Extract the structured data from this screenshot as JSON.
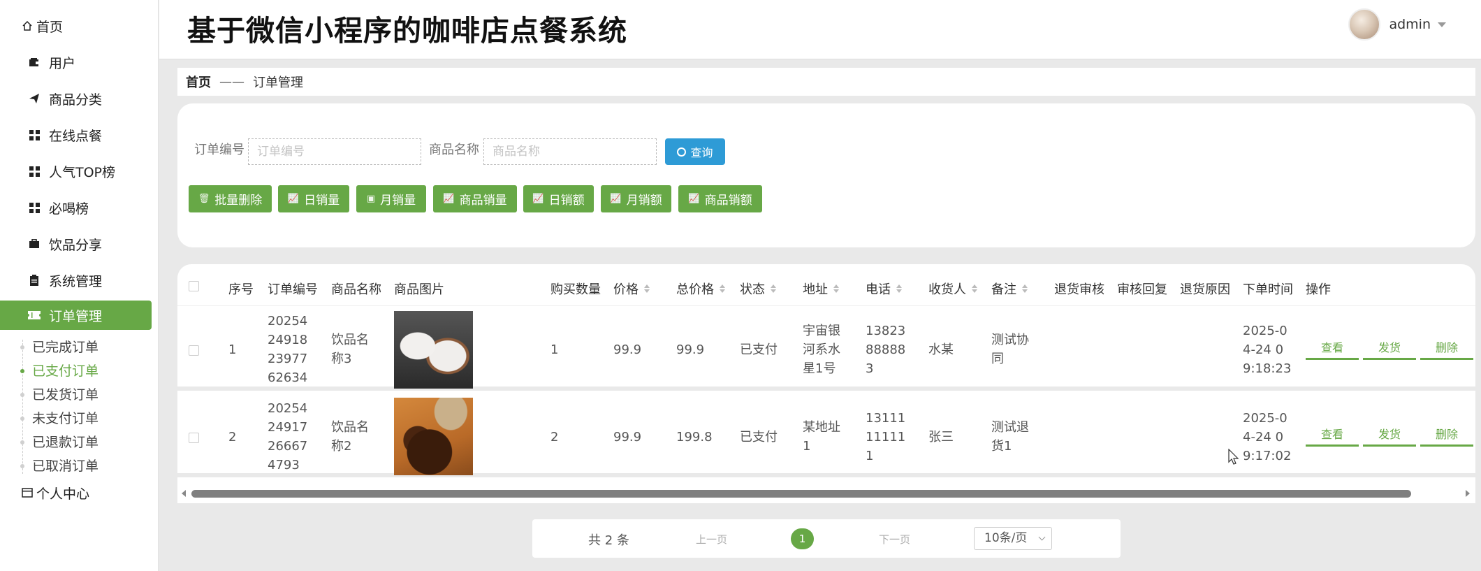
{
  "app": {
    "title": "基于微信小程序的咖啡店点餐系统",
    "user_name": "admin"
  },
  "sidebar": {
    "home": "首页",
    "items": [
      {
        "label": "用户",
        "icon": "wallet-icon"
      },
      {
        "label": "商品分类",
        "icon": "paper-plane-icon"
      },
      {
        "label": "在线点餐",
        "icon": "grid-icon"
      },
      {
        "label": "人气TOP榜",
        "icon": "grid-icon"
      },
      {
        "label": "必喝榜",
        "icon": "grid-icon"
      },
      {
        "label": "饮品分享",
        "icon": "briefcase-icon"
      },
      {
        "label": "系统管理",
        "icon": "clipboard-icon"
      },
      {
        "label": "订单管理",
        "icon": "ticket-icon"
      }
    ],
    "order_children": [
      "已完成订单",
      "已支付订单",
      "已发货订单",
      "未支付订单",
      "已退款订单",
      "已取消订单"
    ],
    "active_child": "已支付订单",
    "personal": "个人中心"
  },
  "breadcrumb": {
    "home": "首页",
    "separator": "——",
    "current": "订单管理"
  },
  "search": {
    "order_no_label": "订单编号",
    "order_no_placeholder": "订单编号",
    "order_no_value": "",
    "product_label": "商品名称",
    "product_placeholder": "商品名称",
    "product_value": "",
    "query_label": "查询"
  },
  "actions": [
    {
      "label": "批量删除",
      "icon": "trash-icon"
    },
    {
      "label": "日销量",
      "icon": "line-chart-icon"
    },
    {
      "label": "月销量",
      "icon": "image-icon"
    },
    {
      "label": "商品销量",
      "icon": "line-chart-icon"
    },
    {
      "label": "日销额",
      "icon": "line-chart-icon"
    },
    {
      "label": "月销额",
      "icon": "line-chart-icon"
    },
    {
      "label": "商品销额",
      "icon": "line-chart-icon"
    }
  ],
  "table": {
    "headers": {
      "seq": "序号",
      "order_no": "订单编号",
      "product_name": "商品名称",
      "product_image": "商品图片",
      "qty": "购买数量",
      "price": "价格",
      "total": "总价格",
      "status": "状态",
      "address": "地址",
      "phone": "电话",
      "receiver": "收货人",
      "remark": "备注",
      "refund_review": "退货审核",
      "review_reply": "审核回复",
      "refund_reason": "退货原因",
      "order_time": "下单时间",
      "ops": "操作"
    },
    "rows": [
      {
        "seq": "1",
        "order_no": [
          "20254",
          "24918",
          "23977",
          "62634"
        ],
        "product_name": [
          "饮品名",
          "称3"
        ],
        "image": "coffee-cups-image",
        "qty": "1",
        "price": "99.9",
        "total": "99.9",
        "status": "已支付",
        "address": [
          "宇宙银",
          "河系水",
          "星1号"
        ],
        "phone": [
          "13823",
          "88888",
          "3"
        ],
        "receiver": "水某",
        "remark": [
          "测试协",
          "同"
        ],
        "order_time": [
          "2025-0",
          "4-24 0",
          "9:18:23"
        ]
      },
      {
        "seq": "2",
        "order_no": [
          "20254",
          "24917",
          "26667",
          "4793"
        ],
        "product_name": [
          "饮品名",
          "称2"
        ],
        "image": "coffee-beans-image",
        "qty": "2",
        "price": "99.9",
        "total": "199.8",
        "status": "已支付",
        "address": [
          "某地址",
          "1"
        ],
        "phone": [
          "13111",
          "11111",
          "1"
        ],
        "receiver": "张三",
        "remark": [
          "测试退",
          "货1"
        ],
        "order_time": [
          "2025-0",
          "4-24 0",
          "9:17:02"
        ]
      }
    ],
    "op_labels": {
      "view": "查看",
      "ship": "发货",
      "delete": "删除"
    }
  },
  "pagination": {
    "total": "共 2 条",
    "prev": "上一页",
    "current_page": "1",
    "next": "下一页",
    "page_size": "10条/页"
  },
  "colors": {
    "accent_green": "#67a846",
    "query_blue": "#2e9bd6",
    "background": "#e9e9e9"
  }
}
